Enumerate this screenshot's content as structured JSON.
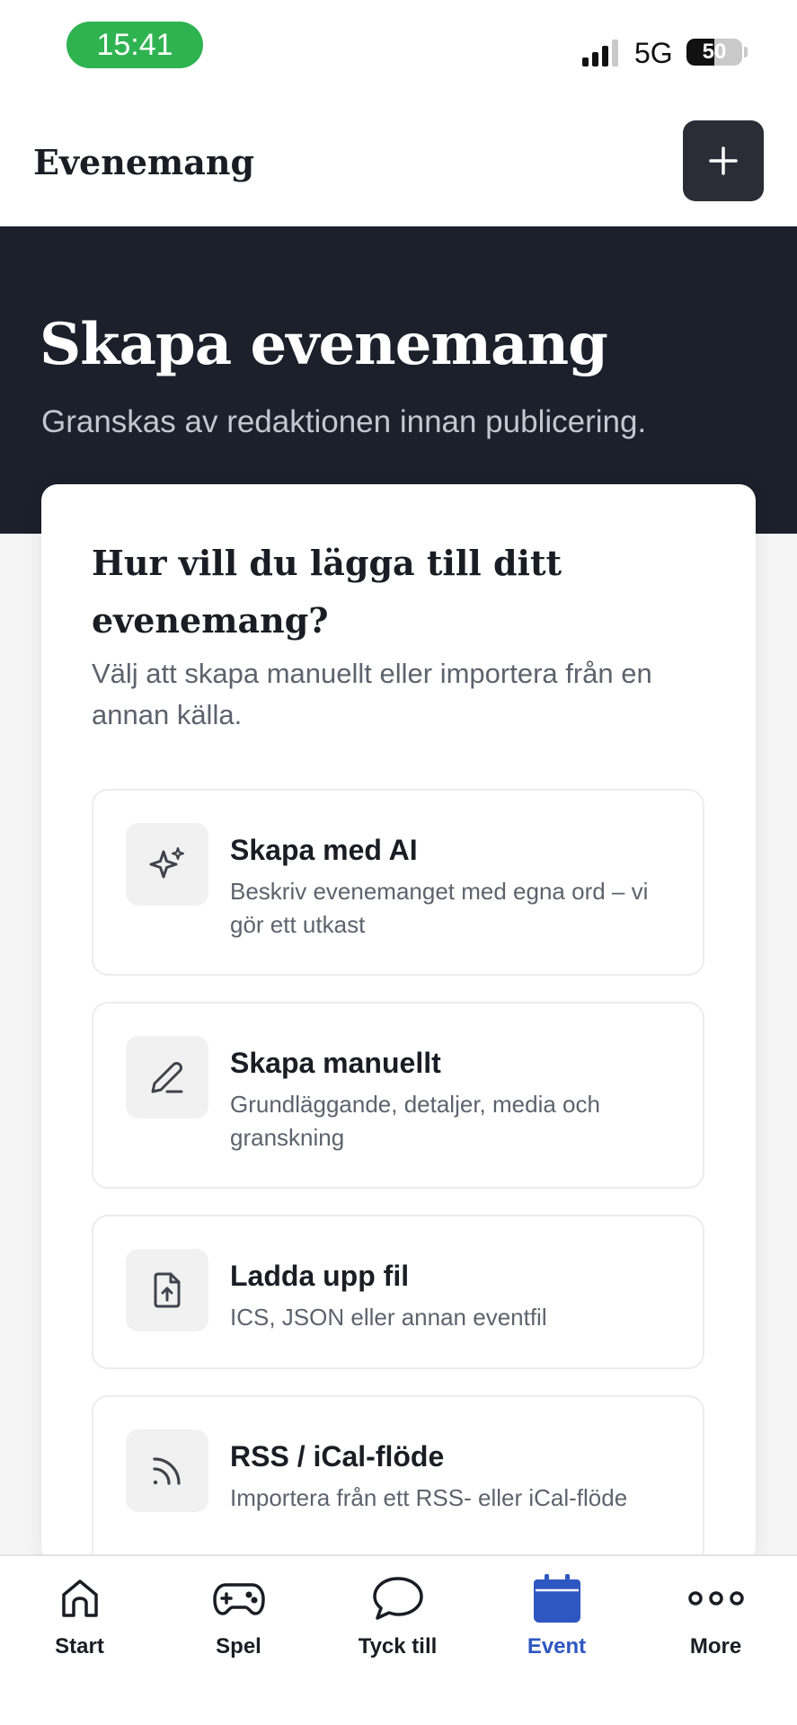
{
  "status_bar": {
    "time": "15:41",
    "network": "5G",
    "battery": "50",
    "battery_level": 0.5,
    "colors": {
      "time_pill": "#2fb350"
    }
  },
  "header": {
    "title": "Evenemang",
    "add_icon": "plus-icon"
  },
  "hero": {
    "title": "Skapa evenemang",
    "subtitle": "Granskas av redaktionen innan publicering."
  },
  "card": {
    "heading": "Hur vill du lägga till ditt evenemang?",
    "description": "Välj att skapa manuellt eller importera från en annan källa.",
    "options": [
      {
        "icon": "sparkles-icon",
        "title": "Skapa med AI",
        "subtitle": "Beskriv evenemanget med egna ord – vi gör ett utkast"
      },
      {
        "icon": "pencil-icon",
        "title": "Skapa manuellt",
        "subtitle": "Grundläggande, detaljer, media och granskning"
      },
      {
        "icon": "file-upload-icon",
        "title": "Ladda upp fil",
        "subtitle": "ICS, JSON eller annan eventfil"
      },
      {
        "icon": "rss-icon",
        "title": "RSS / iCal-flöde",
        "subtitle": "Importera från ett RSS- eller iCal-flöde"
      }
    ]
  },
  "bottom_nav": {
    "items": [
      {
        "label": "Start",
        "icon": "home-icon",
        "active": false
      },
      {
        "label": "Spel",
        "icon": "gamepad-icon",
        "active": false
      },
      {
        "label": "Tyck till",
        "icon": "chat-bubble-icon",
        "active": false
      },
      {
        "label": "Event",
        "icon": "calendar-icon",
        "active": true
      },
      {
        "label": "More",
        "icon": "more-dots-icon",
        "active": false
      }
    ],
    "colors": {
      "active": "#2f57c2",
      "inactive": "#1a1d24"
    }
  },
  "colors": {
    "hero_bg": "#1b202b",
    "button_dark": "#2a2d36"
  }
}
